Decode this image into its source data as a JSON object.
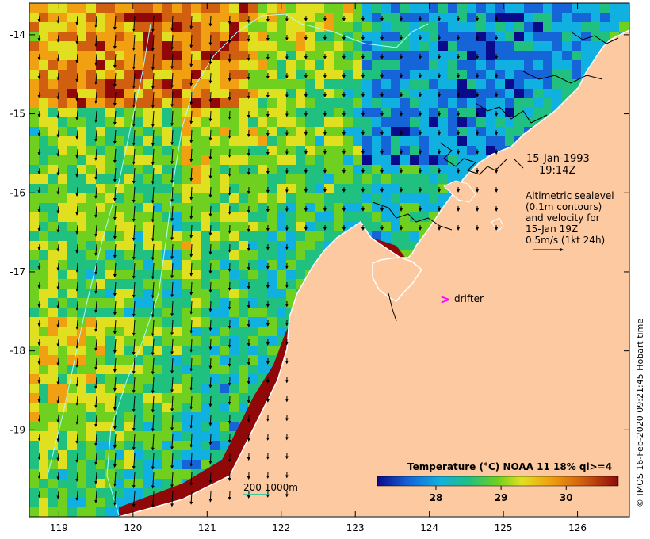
{
  "map": {
    "lon_range": [
      118.6,
      126.7
    ],
    "lat_range": [
      -20.1,
      -13.6
    ],
    "x_ticks": [
      {
        "value": 119,
        "label": "119"
      },
      {
        "value": 120,
        "label": "120"
      },
      {
        "value": 121,
        "label": "121"
      },
      {
        "value": 122,
        "label": "122"
      },
      {
        "value": 123,
        "label": "123"
      },
      {
        "value": 124,
        "label": "124"
      },
      {
        "value": 125,
        "label": "125"
      },
      {
        "value": 126,
        "label": "126"
      }
    ],
    "y_ticks": [
      {
        "value": -14,
        "label": "-14"
      },
      {
        "value": -15,
        "label": "-15"
      },
      {
        "value": -16,
        "label": "-16"
      },
      {
        "value": -17,
        "label": "-17"
      },
      {
        "value": -18,
        "label": "-18"
      },
      {
        "value": -19,
        "label": "-19"
      }
    ]
  },
  "annotations": {
    "date_line1": "15-Jan-1993",
    "date_line2": "19:14Z",
    "alt_line1": "Altimetric sealevel",
    "alt_line2": "(0.1m contours)",
    "alt_line3": "and velocity for",
    "alt_line4": "15-Jan 19Z",
    "alt_line5": "0.5m/s (1kt 24h)",
    "drifter_marker": ">",
    "drifter_label": "drifter",
    "depth_label": "200  1000m"
  },
  "legend": {
    "title": "Temperature (°C) NOAA 11 18% ql>=4",
    "range": [
      27.1,
      30.8
    ],
    "ticks": [
      {
        "value": 28,
        "label": "28"
      },
      {
        "value": 29,
        "label": "29"
      },
      {
        "value": 30,
        "label": "30"
      }
    ],
    "colors": [
      "#0a0a8c",
      "#1565d8",
      "#10b0e0",
      "#20c080",
      "#70d020",
      "#e0e020",
      "#f0a010",
      "#d06010",
      "#900808"
    ]
  },
  "copyright": "© IMOS 16-Feb-2020 09:21:45 Hobart time",
  "colors": {
    "land": "#fcc9a0",
    "coast_outline": "#ffffff",
    "contour": "#aaffff",
    "drifter": "#ff00ff",
    "depth_200": "#00c8a0"
  }
}
